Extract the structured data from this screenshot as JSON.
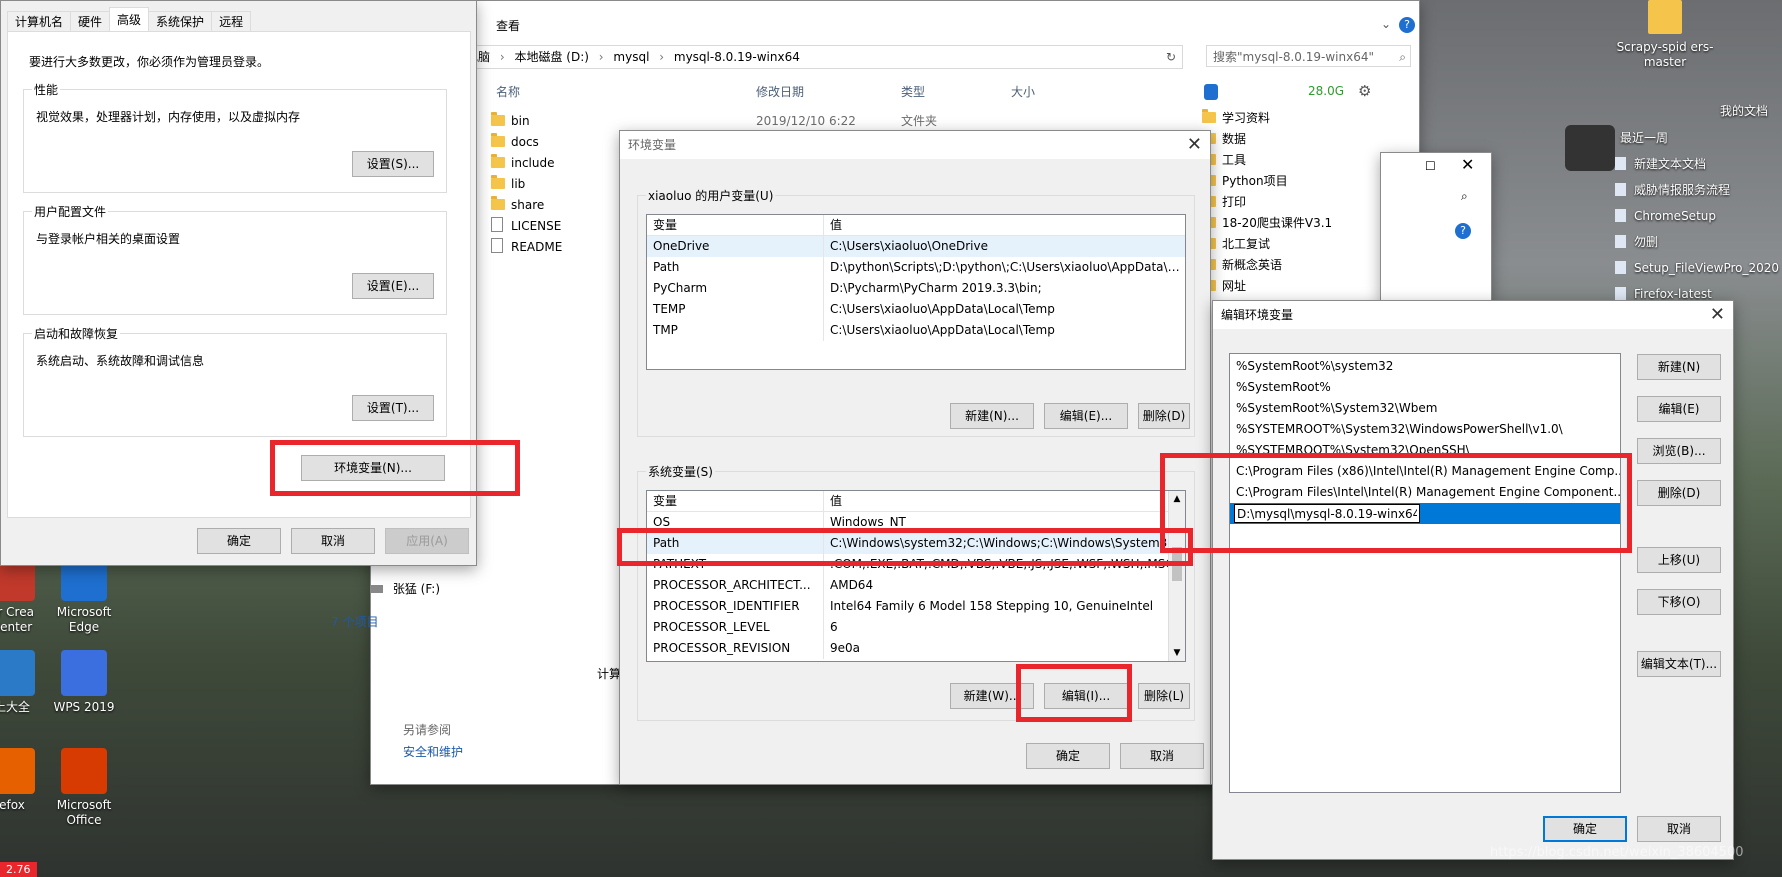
{
  "explorer": {
    "title_fragment": "mysql-8.0.19-winx64",
    "ribbon_tab": "查看",
    "breadcrumb": [
      "电脑",
      "本地磁盘 (D:)",
      "mysql",
      "mysql-8.0.19-winx64"
    ],
    "search_placeholder": "搜索\"mysql-8.0.19-winx64\"",
    "columns": [
      "名称",
      "修改日期",
      "类型",
      "大小"
    ],
    "files": [
      {
        "name": "bin",
        "date": "2019/12/10 6:22",
        "type": "文件夹",
        "kind": "folder"
      },
      {
        "name": "docs",
        "kind": "folder"
      },
      {
        "name": "include",
        "kind": "folder"
      },
      {
        "name": "lib",
        "kind": "folder"
      },
      {
        "name": "share",
        "kind": "folder"
      },
      {
        "name": "LICENSE",
        "kind": "file"
      },
      {
        "name": "README",
        "kind": "file"
      }
    ],
    "nav_drive": "张猛 (F:)",
    "item_count": "7 个项目",
    "see_also_label": "另请参阅",
    "see_also_link": "安全和维护",
    "computer_label": "计算"
  },
  "quick_panel": {
    "disk_free": "28.0G",
    "folders": [
      "学习资料",
      "数据",
      "工具",
      "Python项目",
      "打印",
      "18-20爬虫课件V3.1",
      "北工复试",
      "新概念英语",
      "网址"
    ]
  },
  "sysprops": {
    "tabs": [
      "计算机名",
      "硬件",
      "高级",
      "系统保护",
      "远程"
    ],
    "active_tab": 2,
    "notice": "要进行大多数更改，你必须作为管理员登录。",
    "performance": {
      "title": "性能",
      "desc": "视觉效果，处理器计划，内存使用，以及虚拟内存",
      "button": "设置(S)..."
    },
    "profiles": {
      "title": "用户配置文件",
      "desc": "与登录帐户相关的桌面设置",
      "button": "设置(E)..."
    },
    "startup": {
      "title": "启动和故障恢复",
      "desc": "系统启动、系统故障和调试信息",
      "button": "设置(T)..."
    },
    "env_button": "环境变量(N)...",
    "ok": "确定",
    "cancel": "取消",
    "apply": "应用(A)"
  },
  "envvars": {
    "title": "环境变量",
    "user_group": "xiaoluo 的用户变量(U)",
    "col_var": "变量",
    "col_val": "值",
    "user_vars": [
      {
        "name": "OneDrive",
        "value": "C:\\Users\\xiaoluo\\OneDrive"
      },
      {
        "name": "Path",
        "value": "D:\\python\\Scripts\\;D:\\python\\;C:\\Users\\xiaoluo\\AppData\\Loc..."
      },
      {
        "name": "PyCharm",
        "value": "D:\\Pycharm\\PyCharm 2019.3.3\\bin;"
      },
      {
        "name": "TEMP",
        "value": "C:\\Users\\xiaoluo\\AppData\\Local\\Temp"
      },
      {
        "name": "TMP",
        "value": "C:\\Users\\xiaoluo\\AppData\\Local\\Temp"
      }
    ],
    "user_buttons": [
      "新建(N)...",
      "编辑(E)...",
      "删除(D)"
    ],
    "sys_group": "系统变量(S)",
    "sys_vars": [
      {
        "name": "OS",
        "value": "Windows_NT"
      },
      {
        "name": "Path",
        "value": "C:\\Windows\\system32;C:\\Windows;C:\\Windows\\System32\\Wb..."
      },
      {
        "name": "PATHEXT",
        "value": ".COM;.EXE;.BAT;.CMD;.VBS;.VBE;.JS;.JSE;.WSF;.WSH;.MSC"
      },
      {
        "name": "PROCESSOR_ARCHITECT...",
        "value": "AMD64"
      },
      {
        "name": "PROCESSOR_IDENTIFIER",
        "value": "Intel64 Family 6 Model 158 Stepping 10, GenuineIntel"
      },
      {
        "name": "PROCESSOR_LEVEL",
        "value": "6"
      },
      {
        "name": "PROCESSOR_REVISION",
        "value": "9e0a"
      }
    ],
    "sys_buttons": [
      "新建(W)...",
      "编辑(I)...",
      "删除(L)"
    ],
    "ok": "确定",
    "cancel": "取消"
  },
  "editenv": {
    "title": "编辑环境变量",
    "entries": [
      "%SystemRoot%\\system32",
      "%SystemRoot%",
      "%SystemRoot%\\System32\\Wbem",
      "%SYSTEMROOT%\\System32\\WindowsPowerShell\\v1.0\\",
      "%SYSTEMROOT%\\System32\\OpenSSH\\",
      "C:\\Program Files (x86)\\Intel\\Intel(R) Management Engine Comp...",
      "C:\\Program Files\\Intel\\Intel(R) Management Engine Component..."
    ],
    "editing_value": "D:\\mysql\\mysql-8.0.19-winx64",
    "buttons": [
      "新建(N)",
      "编辑(E)",
      "浏览(B)...",
      "删除(D)",
      "上移(U)",
      "下移(O)",
      "编辑文本(T)..."
    ],
    "ok": "确定",
    "cancel": "取消"
  },
  "behind_window": {
    "title": ""
  },
  "desktop": {
    "right_icons": [
      "Scrapy-spid ers-master"
    ],
    "my_docs": "我的文档",
    "recent_week": "最近一周",
    "recent_items": [
      "新建文本文档",
      "威胁情报服务流程",
      "ChromeSetup",
      "勿删",
      "Setup_FileViewPro_2020",
      "Firefox-latest"
    ],
    "left_icons": [
      {
        "label": "er Crea Center",
        "color": "#c0392b"
      },
      {
        "label": "Microsoft Edge",
        "color": "#1e6fd0"
      },
      {
        "label": "上大全",
        "color": "#2a7ac7"
      },
      {
        "label": "WPS 2019",
        "color": "#3b6fe0"
      },
      {
        "label": "efox",
        "color": "#e66000"
      },
      {
        "label": "Microsoft Office",
        "color": "#d83b01"
      }
    ],
    "badge": "2.76",
    "watermark": "https://blog.csdn.net/weixin_38604500"
  },
  "accent_red": "#e8262b",
  "selection_blue": "#0078d7"
}
